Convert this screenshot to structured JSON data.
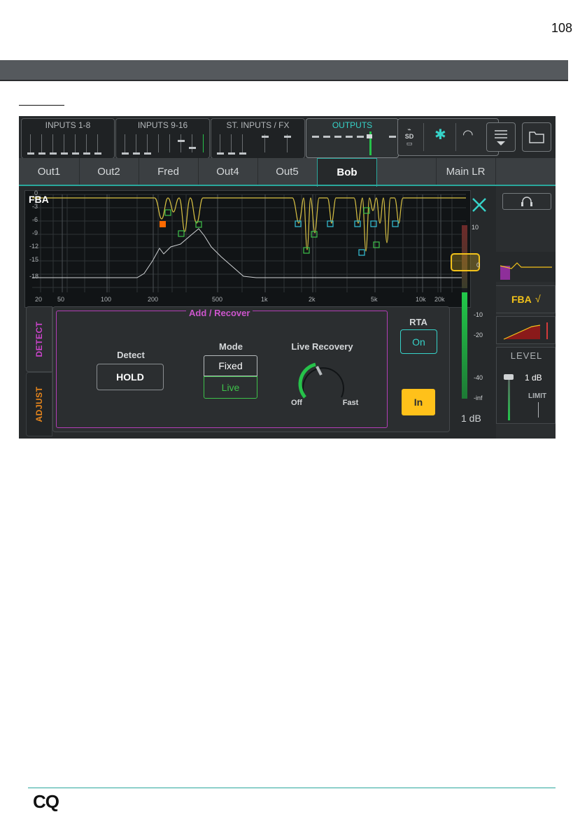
{
  "page_number": "108",
  "strip_groups": [
    {
      "label": "INPUTS 1-8"
    },
    {
      "label": "INPUTS 9-16"
    },
    {
      "label": "ST. INPUTS / FX"
    },
    {
      "label": "OUTPUTS"
    }
  ],
  "tabs": [
    {
      "label": "Out1"
    },
    {
      "label": "Out2"
    },
    {
      "label": "Fred"
    },
    {
      "label": "Out4"
    },
    {
      "label": "Out5"
    },
    {
      "label": "Bob"
    },
    {
      "label": ""
    },
    {
      "label": "Main LR"
    }
  ],
  "graph": {
    "title": "FBA",
    "y_ticks": [
      "0",
      "-3",
      "-6",
      "-9",
      "-12",
      "-15",
      "-18"
    ],
    "x_ticks": [
      "20",
      "50",
      "100",
      "200",
      "500",
      "1k",
      "2k",
      "5k",
      "10k",
      "20k"
    ]
  },
  "side_tabs": {
    "detect": "DETECT",
    "adjust": "ADJUST"
  },
  "panel": {
    "title": "Add / Recover",
    "detect_label": "Detect",
    "hold_button": "HOLD",
    "mode_label": "Mode",
    "mode_fixed": "Fixed",
    "mode_live": "Live",
    "live_recovery_label": "Live Recovery",
    "knob_off": "Off",
    "knob_fast": "Fast",
    "rta_label": "RTA",
    "rta_button": "On",
    "in_button": "In"
  },
  "meter": {
    "scale": [
      "10",
      "0",
      "-10",
      "-20",
      "-40",
      "-inf"
    ],
    "value_label": "1 dB"
  },
  "right_panel": {
    "fba_label": "FBA",
    "level_title": "LEVEL",
    "level_value": "1 dB",
    "limit_label": "LIMIT"
  },
  "footer": {
    "logo": "CQ"
  }
}
